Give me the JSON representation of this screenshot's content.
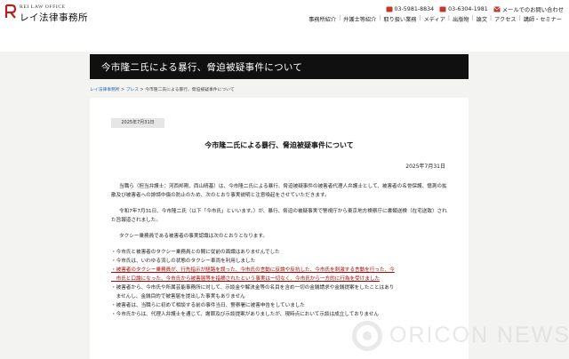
{
  "header": {
    "logo_en": "REI LAW OFFICE",
    "logo_jp": "レイ法律事務所",
    "contacts": [
      {
        "icon": "phone-icon",
        "text": "03-5981-8834"
      },
      {
        "icon": "phone-icon",
        "text": "03-6304-1981"
      },
      {
        "icon": "mail-icon",
        "text": "メールでのお問い合わせ"
      }
    ],
    "nav": [
      "事務所紹介",
      "弁護士等紹介",
      "取り扱い業務",
      "メディア",
      "出版物",
      "論文",
      "アクセス",
      "講師・セミナー"
    ]
  },
  "banner": {
    "title": "今市隆二氏による暴行、脅迫被疑事件について"
  },
  "breadcrumb": {
    "items": [
      "レイ法律事務所",
      "プレス",
      "今市隆二氏による暴行、脅迫被疑事件について"
    ],
    "separator": ">"
  },
  "article": {
    "badge_date": "2025年7月31日",
    "title": "今市隆二氏による暴行、脅迫被疑事件について",
    "date": "2025年7月31日",
    "p1": "当職ら（担当弁護士：河西邦剛、西山晴基）は、今市隆二氏による暴行、脅迫被疑事件の被害者代理人弁護士として、被害者の名誉保護、憶測の拡散及び被害者への誹謗中傷の防止のため、次のとおり事実説明と注意喚起をさせていただきます。",
    "p2": "令和7年7月31日、今市隆二氏（以下「今市氏」といいます。）が、暴行、脅迫の被疑事実で警視庁から東京地方検察庁に書類送検（在宅送致）された旨報道されました。",
    "p3": "タクシー乗務員である被害者の事実認識は次のとおりとなります。",
    "bullets": [
      "・今市氏と被害者のタクシー乗務員との間に従前の面識はありませんでした",
      "・今市氏は、いわゆる流しの状態のタクシー車両を利用しました",
      "・被害者のタクシー乗務員が、行先指示が経路を誤った、今市氏の言動に反論や反抗した、今市氏を刺激する言動を行った、今",
      "　市氏と口論になった、今市氏から被害届等を指摘されたという事実は一切なく、今市氏から一方的に行為を受けました",
      "・被害者から、今市氏や所属芸能事務所に対して、示談金や解決金等の名目を含め一切の金銭請求や金銭提案をしたことはあり",
      "　ませんし、金銭目的で被害届を提出した事実もありません",
      "・被害者は、当職らに初めて相談する前の事件当日、警察署に被害申告をしていました",
      "・今市氏からは、代理人弁護士を通じて、謝罪及び示談提案がありましたが、現時点において示談は成立しておりません"
    ]
  },
  "watermark": {
    "text": "ORICON NEWS"
  }
}
